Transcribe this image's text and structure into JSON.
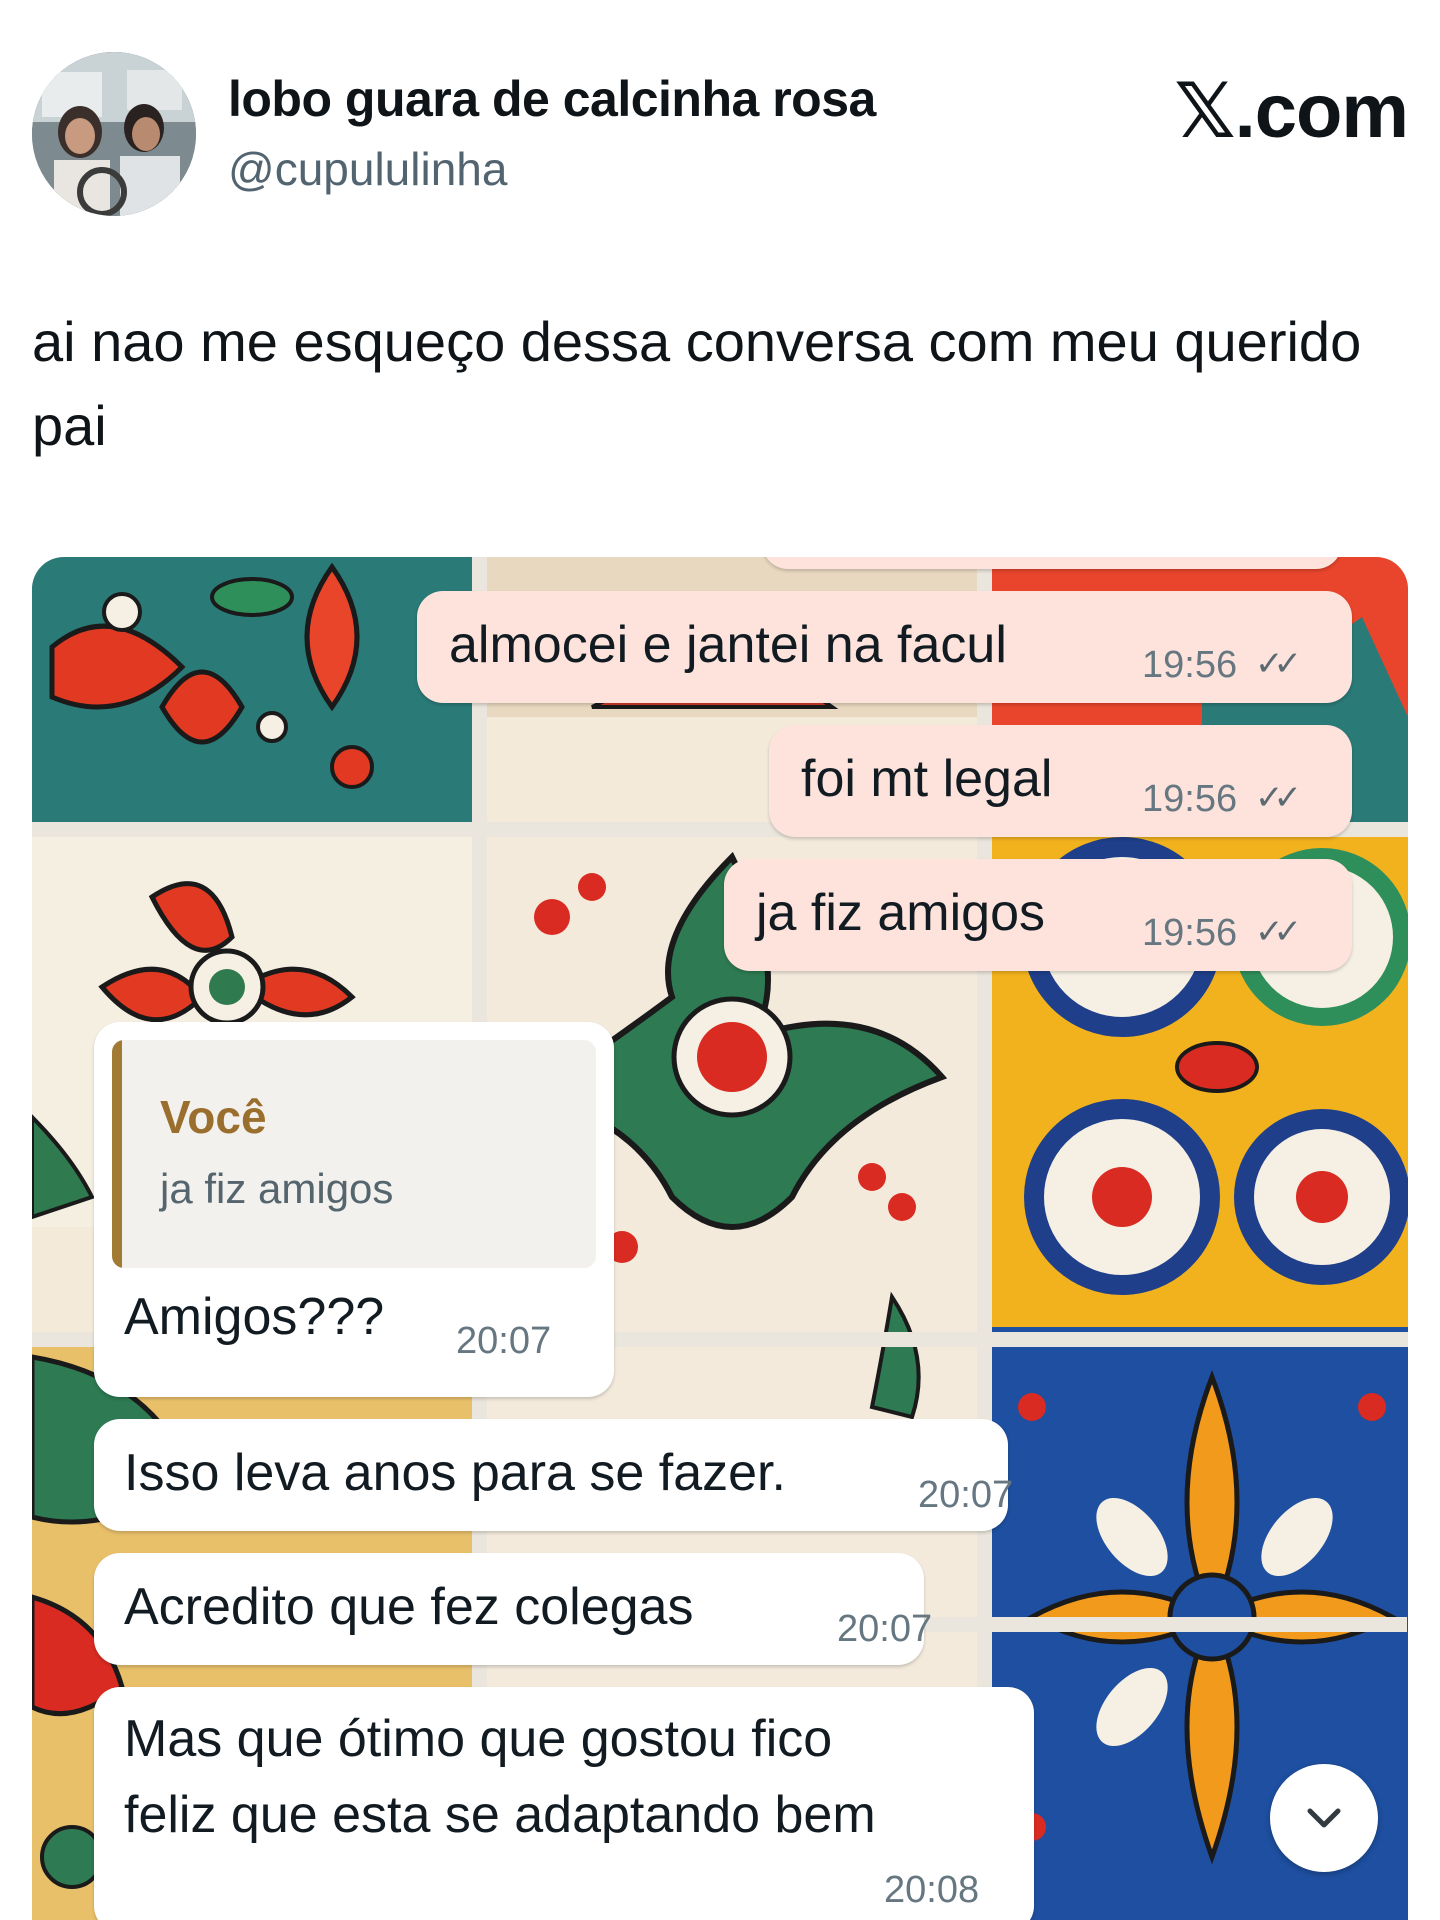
{
  "tweet": {
    "author_name": "lobo guara de calcinha rosa",
    "author_handle": "@cupululinha",
    "site_logo": "𝕏.com",
    "text": "ai nao me esqueço dessa conversa com meu querido pai"
  },
  "chat": {
    "outgoing": [
      {
        "text": "almocei e jantei na facul",
        "time": "19:56",
        "status": "read"
      },
      {
        "text": "foi mt legal",
        "time": "19:56",
        "status": "read"
      },
      {
        "text": "ja fiz amigos",
        "time": "19:56",
        "status": "read"
      }
    ],
    "reply_quote": {
      "author": "Você",
      "text": "ja fiz amigos"
    },
    "incoming": [
      {
        "text": "Amigos???",
        "time": "20:07"
      },
      {
        "text": "Isso leva anos para se fazer.",
        "time": "20:07"
      },
      {
        "text": "Acredito que fez colegas",
        "time": "20:07"
      },
      {
        "line1": "Mas que ótimo que gostou fico",
        "line2": "feliz que esta se adaptando bem",
        "time": "20:08"
      }
    ],
    "read_ticks": "✓✓",
    "scroll_icon": "chevron-down-icon"
  },
  "colors": {
    "outgoing_bubble": "#fde3dc",
    "incoming_bubble": "#ffffff",
    "quote_accent": "#a17a34"
  }
}
